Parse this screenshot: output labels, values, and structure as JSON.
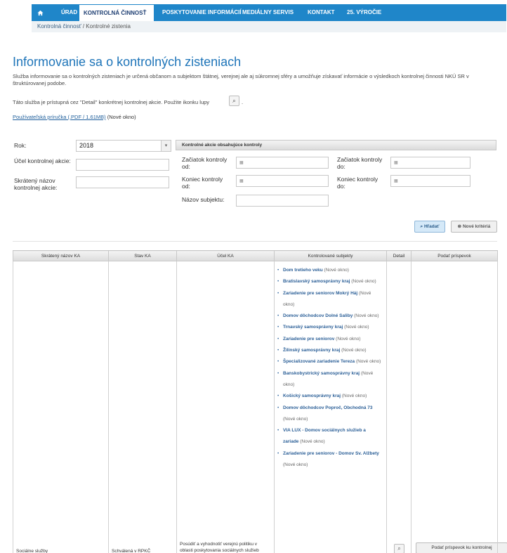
{
  "nav": {
    "home_icon": "home-icon",
    "items": [
      "ÚRAD",
      "KONTROLNÁ ČINNOSŤ",
      "POSKYTOVANIE INFORMÁCIÍ",
      "MEDIÁLNY SERVIS",
      "KONTAKT",
      "25. VÝROČIE"
    ],
    "active_index": 1,
    "colors": {
      "bar": "#1f86c9",
      "active_text": "#1f3f73"
    }
  },
  "breadcrumb": {
    "link": "Kontrolná činnosť",
    "separator": "/",
    "current": "Kontrolné zistenia"
  },
  "page": {
    "title": "Informovanie sa o kontrolných zisteniach",
    "description": "Služba informovanie sa o kontrolných zisteniach je určená občanom a subjektom štátnej, verejnej ale aj súkromnej sféry a umožňuje získavať informácie o výsledkoch kontrolnej činnosti NKÚ SR v štruktúrovanej podobe.",
    "detail_hint": "Táto služba je prístupná cez \"Detail\" konkrétnej kontrolnej akcie. Použite ikonku lupy",
    "detail_hint_end": ".",
    "manual_link": "Používateľská príručka (.PDF / 1.61MB)",
    "manual_note": "(Nové okno)",
    "title_color": "#1f75b9"
  },
  "filters": {
    "rok_label": "Rok:",
    "rok_value": "2018",
    "panel_header": "Kontrolné akcie obsahujúce kontroly",
    "ucel_label": "Účel kontrolnej akcie:",
    "skrateny_label": "Skrátený názov kontrolnej akcie:",
    "zaciatok_od_label": "Začiatok kontroly od:",
    "zaciatok_do_label": "Začiatok kontroly do:",
    "koniec_od_label": "Koniec kontroly od:",
    "koniec_do_label": "Koniec kontroly do:",
    "nazov_subjektu_label": "Názov subjektu:",
    "calendar_icon": "calendar-icon"
  },
  "buttons": {
    "search": "Hľadať",
    "new_criteria": "Nové kritériá"
  },
  "table": {
    "headers": [
      "Skrátený názov KA",
      "Stav KA",
      "Účel KA",
      "Kontrolované subjekty",
      "Detail",
      "Podať príspevok"
    ],
    "row": {
      "name": "Sociálne služby",
      "status": "Schválená v RPKČ",
      "purpose": "Posúdiť a vyhodnotiť verejnú politiku v oblasti poskytovania sociálnych služieb",
      "subjects": [
        {
          "name": "Dom tretieho veku",
          "note": "(Nové okno)"
        },
        {
          "name": "Bratislavský samosprávny kraj",
          "note": "(Nové okno)"
        },
        {
          "name": "Zariadenie pre seniorov Mokrý Háj",
          "note": "(Nové okno)"
        },
        {
          "name": "Domov dôchodcov Dolné Saliby",
          "note": "(Nové okno)"
        },
        {
          "name": "Trnavský samosprávny kraj",
          "note": "(Nové okno)"
        },
        {
          "name": "Zariadenie pre seniorov",
          "note": "(Nové okno)"
        },
        {
          "name": "Žilinský samosprávny kraj",
          "note": "(Nové okno)"
        },
        {
          "name": "Špecializované zariadenie Tereza",
          "note": "(Nové okno)"
        },
        {
          "name": "Banskobystrický samosprávny kraj",
          "note": "(Nové okno)"
        },
        {
          "name": "Košický samosprávny kraj",
          "note": "(Nové okno)"
        },
        {
          "name": "Domov dôchodcov Poproč, Obchodná 73",
          "note": "(Nové okno)"
        },
        {
          "name": "VIA LUX - Domov sociálnych služieb a zariade",
          "note": "(Nové okno)"
        },
        {
          "name": "Zariadenie pre seniorov - Domov Sv. Alžbety",
          "note": "(Nové okno)"
        }
      ],
      "submit": "Podať príspevok ku kontrolnej"
    }
  }
}
